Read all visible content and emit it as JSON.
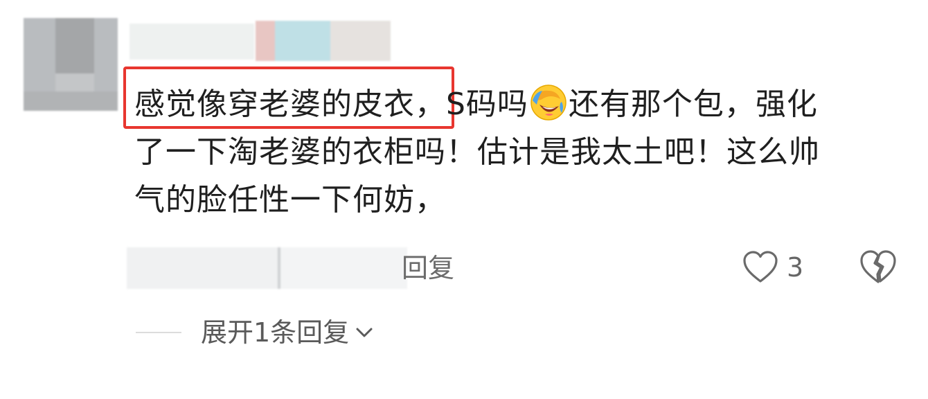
{
  "comment": {
    "line1_before_emoji": "感觉像穿老婆的皮衣，S码吗",
    "line1_after_emoji": "还有那个包，强化",
    "line2": "了一下淘老婆的衣柜吗！估计是我太土吧！这么帅",
    "line3": "气的脸任性一下何妨，"
  },
  "emoji_icon": "laughing-tears-emoji",
  "actions": {
    "reply_label": "回复",
    "like_count": "3",
    "expand_label": "展开1条回复"
  },
  "colors": {
    "highlight_border": "#e8362f",
    "text": "#1f1f1f",
    "secondary_text": "#6b6b6b"
  }
}
